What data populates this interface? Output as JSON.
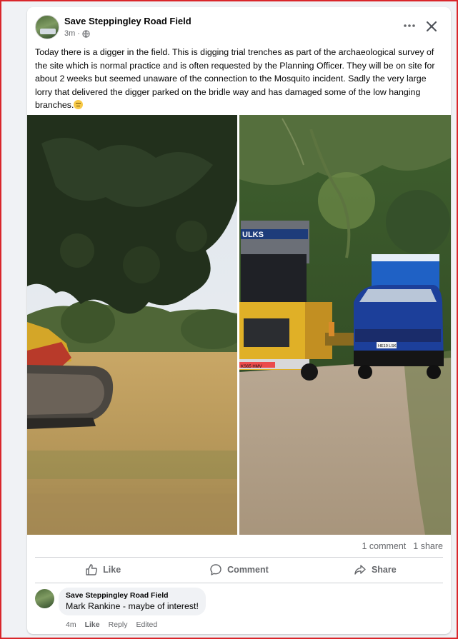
{
  "post": {
    "page_name": "Save Steppingley Road Field",
    "time": "3m",
    "separator": "·",
    "privacy_icon": "globe-icon",
    "text": "Today there is a digger in the field. This is digging trial trenches as part of the archaeological survey of the site which is normal practice and is often requested by the Planning Officer.  They will be on site for about 2 weeks but seemed unaware of the connection to the Mosquito incident.  Sadly the very large lorry that delivered the digger parked on the bridle way and has damaged some of the low hanging branches.",
    "emoji": "face-emoji"
  },
  "photos": {
    "left": {
      "lorry_sign": ""
    },
    "right": {
      "lorry_sign": "ULKS",
      "plate_lorry": "KS65 HMV",
      "plate_van": "HE10 LSK"
    }
  },
  "stats": {
    "comments": "1 comment",
    "shares": "1 share"
  },
  "actions": {
    "like": "Like",
    "comment": "Comment",
    "share": "Share"
  },
  "comment": {
    "author": "Save Steppingley Road Field",
    "text": "Mark Rankine - maybe of interest!",
    "time": "4m",
    "like": "Like",
    "reply": "Reply",
    "edited": "Edited"
  },
  "colors": {
    "frame": "#d9262b",
    "card": "#ffffff",
    "background": "#f0f2f5",
    "secondary_text": "#65676b"
  }
}
